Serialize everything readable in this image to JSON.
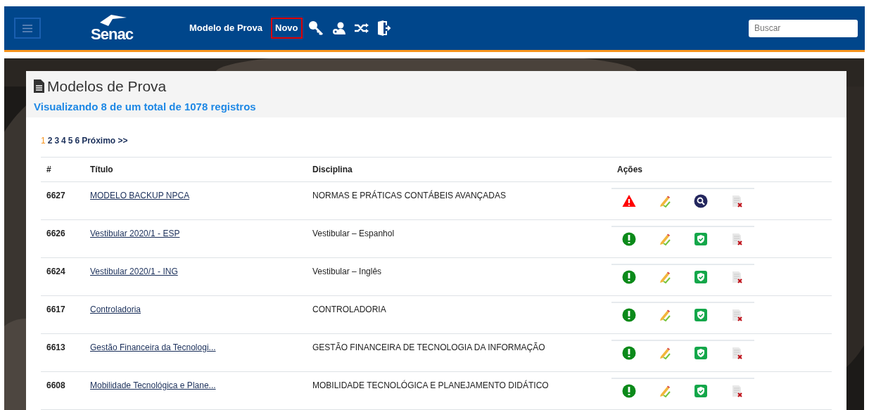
{
  "navbar": {
    "logo": "Senac",
    "menu_items": [
      {
        "label": "Modelo de Prova",
        "selected": false
      },
      {
        "label": "Novo",
        "selected": true
      }
    ],
    "search": {
      "placeholder": "Buscar"
    }
  },
  "panel": {
    "title": "Modelos de Prova",
    "subtitle": "Visualizando 8 de um total de 1078 registros"
  },
  "pagination": {
    "pages": [
      {
        "label": "1",
        "selected": true
      },
      {
        "label": "2",
        "selected": false
      },
      {
        "label": "3",
        "selected": false
      },
      {
        "label": "4",
        "selected": false
      },
      {
        "label": "5",
        "selected": false
      },
      {
        "label": "6",
        "selected": false
      }
    ],
    "next": "Próximo >>"
  },
  "table": {
    "columns": [
      "#",
      "Título",
      "Disciplina",
      "Ações"
    ],
    "rows": [
      {
        "id": "6627",
        "title": "MODELO BACKUP NPCA",
        "discipline": "NORMAS E PRÁTICAS CONTÁBEIS AVANÇADAS",
        "actions": [
          {
            "kind": "warning"
          },
          {
            "kind": "edit"
          },
          {
            "kind": "search"
          },
          {
            "kind": "delete"
          }
        ]
      },
      {
        "id": "6626",
        "title": "Vestibular 2020/1 - ESP",
        "discipline": "Vestibular – Espanhol",
        "actions": [
          {
            "kind": "alert"
          },
          {
            "kind": "edit"
          },
          {
            "kind": "approved"
          },
          {
            "kind": "delete"
          }
        ]
      },
      {
        "id": "6624",
        "title": "Vestibular 2020/1 - ING",
        "discipline": "Vestibular – Inglês",
        "actions": [
          {
            "kind": "alert"
          },
          {
            "kind": "edit"
          },
          {
            "kind": "approved"
          },
          {
            "kind": "delete"
          }
        ]
      },
      {
        "id": "6617",
        "title": "Controladoria",
        "discipline": "CONTROLADORIA",
        "actions": [
          {
            "kind": "alert"
          },
          {
            "kind": "edit"
          },
          {
            "kind": "approved"
          },
          {
            "kind": "delete"
          }
        ]
      },
      {
        "id": "6613",
        "title": "Gestão Financeira da Tecnologi...",
        "discipline": "GESTÃO FINANCEIRA DE TECNOLOGIA DA INFORMAÇÃO",
        "actions": [
          {
            "kind": "alert"
          },
          {
            "kind": "edit"
          },
          {
            "kind": "approved"
          },
          {
            "kind": "delete"
          }
        ]
      },
      {
        "id": "6608",
        "title": "Mobilidade Tecnológica e Plane...",
        "discipline": "MOBILIDADE TECNOLÓGICA E PLANEJAMENTO DIDÁTICO",
        "actions": [
          {
            "kind": "alert"
          },
          {
            "kind": "edit"
          },
          {
            "kind": "approved"
          },
          {
            "kind": "delete"
          }
        ]
      }
    ]
  }
}
